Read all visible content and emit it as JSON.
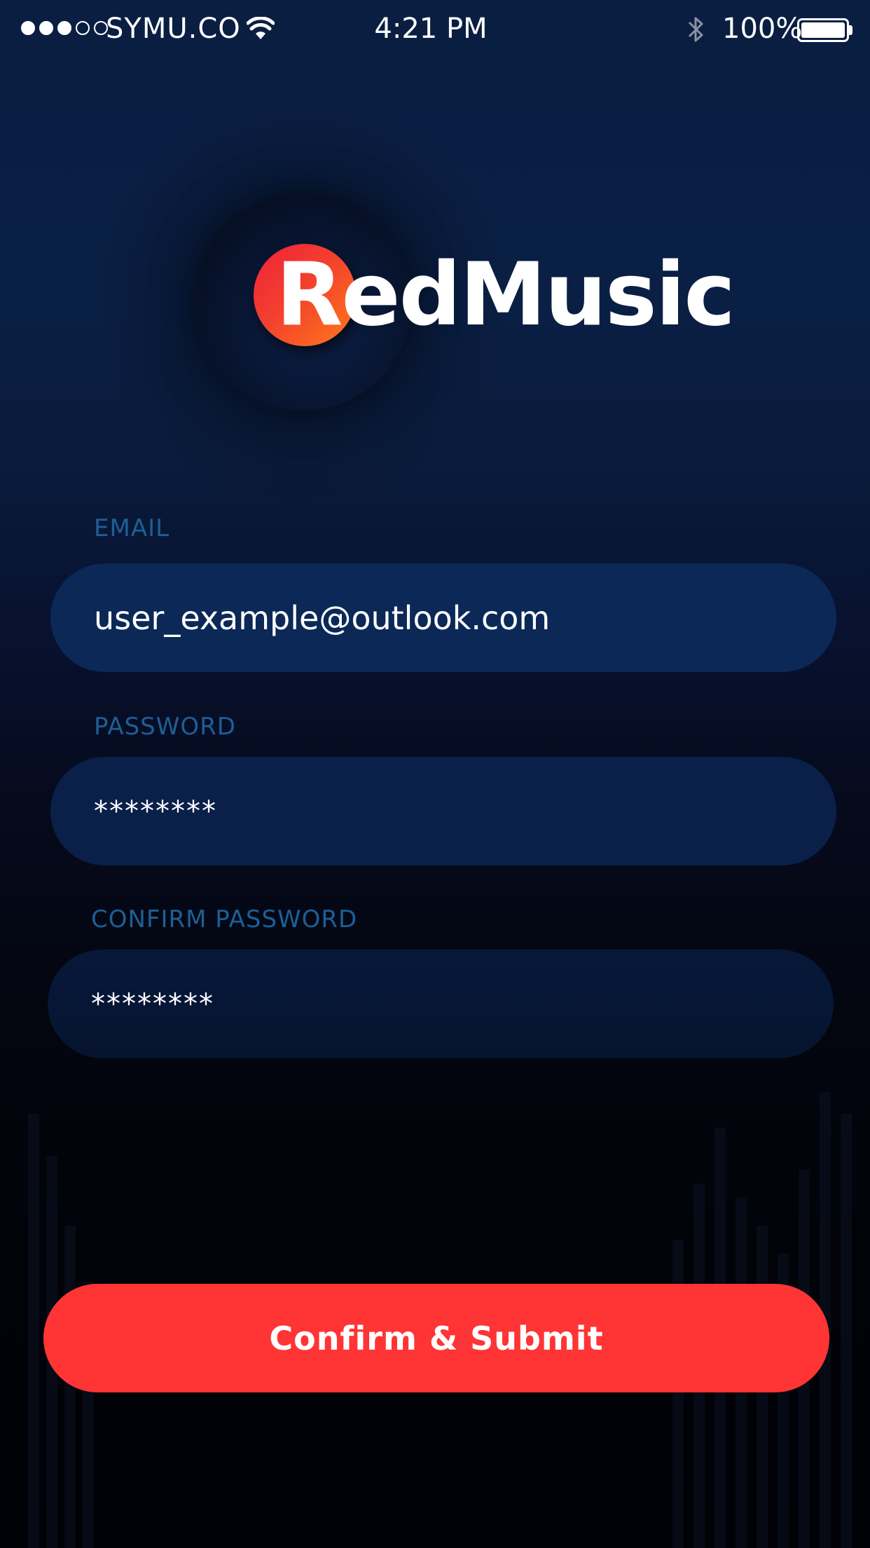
{
  "status_bar": {
    "signal_bars_filled": 3,
    "signal_bars_total": 5,
    "carrier": "SYMU.CO",
    "time": "4:21 PM",
    "battery_percent": "100%",
    "icons": [
      "wifi-icon",
      "bluetooth-icon",
      "battery-icon"
    ]
  },
  "logo": {
    "text": "RedMusic",
    "mark_colors": [
      "#f0203a",
      "#ff7a1a"
    ]
  },
  "form": {
    "email": {
      "label": "EMAIL",
      "value": "user_example@outlook.com"
    },
    "password": {
      "label": "PASSWORD",
      "value": "********"
    },
    "confirm_password": {
      "label": "CONFIRM PASSWORD",
      "value": "********"
    }
  },
  "submit": {
    "label": "Confirm & Submit"
  },
  "colors": {
    "accent": "#ff3435",
    "label": "#1d5f95",
    "field_background": "#0b2857",
    "background_top": "#0a1e42",
    "background_bottom": "#010309"
  }
}
